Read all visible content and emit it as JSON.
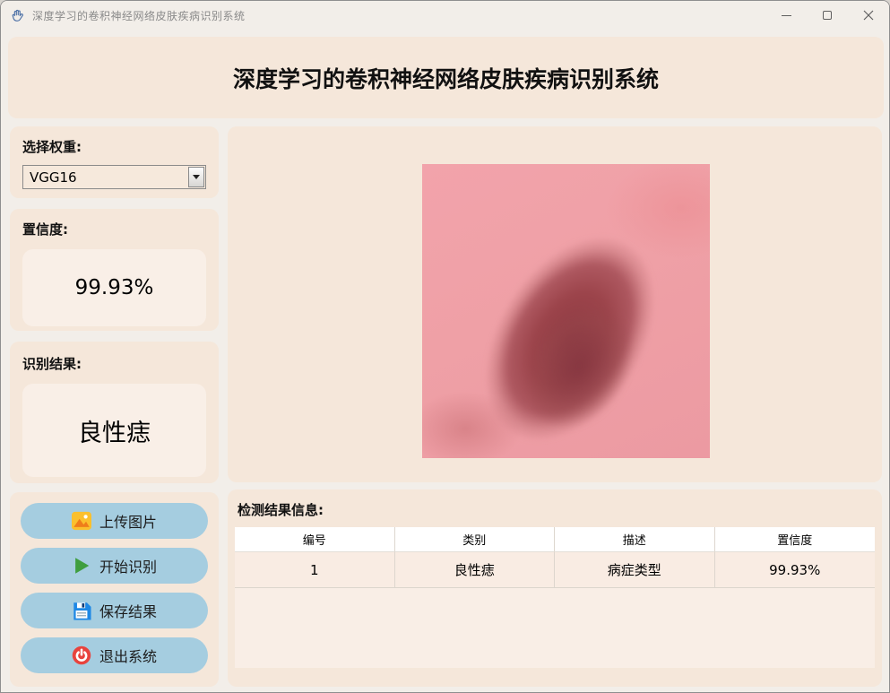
{
  "window": {
    "title": "深度学习的卷积神经网络皮肤疾病识别系统"
  },
  "header": {
    "title": "深度学习的卷积神经网络皮肤疾病识别系统"
  },
  "sidebar": {
    "weights": {
      "label": "选择权重:",
      "selected": "VGG16"
    },
    "confidence": {
      "label": "置信度:",
      "value": "99.93%"
    },
    "result": {
      "label": "识别结果:",
      "value": "良性痣"
    },
    "buttons": [
      {
        "label": "上传图片",
        "icon": "image-upload-icon"
      },
      {
        "label": "开始识别",
        "icon": "play-icon"
      },
      {
        "label": "保存结果",
        "icon": "save-icon"
      },
      {
        "label": "退出系统",
        "icon": "power-icon"
      }
    ]
  },
  "results": {
    "label": "检测结果信息:",
    "table": {
      "headers": [
        "编号",
        "类别",
        "描述",
        "置信度"
      ],
      "rows": [
        [
          "1",
          "良性痣",
          "病症类型",
          "99.93%"
        ]
      ]
    }
  },
  "colors": {
    "panel_bg": "#f5e7da",
    "inner_box_bg": "#f9efe7",
    "button_bg": "#a5cde0",
    "confidence_green": "#1f9d3f",
    "window_bg": "#f2eee9"
  }
}
